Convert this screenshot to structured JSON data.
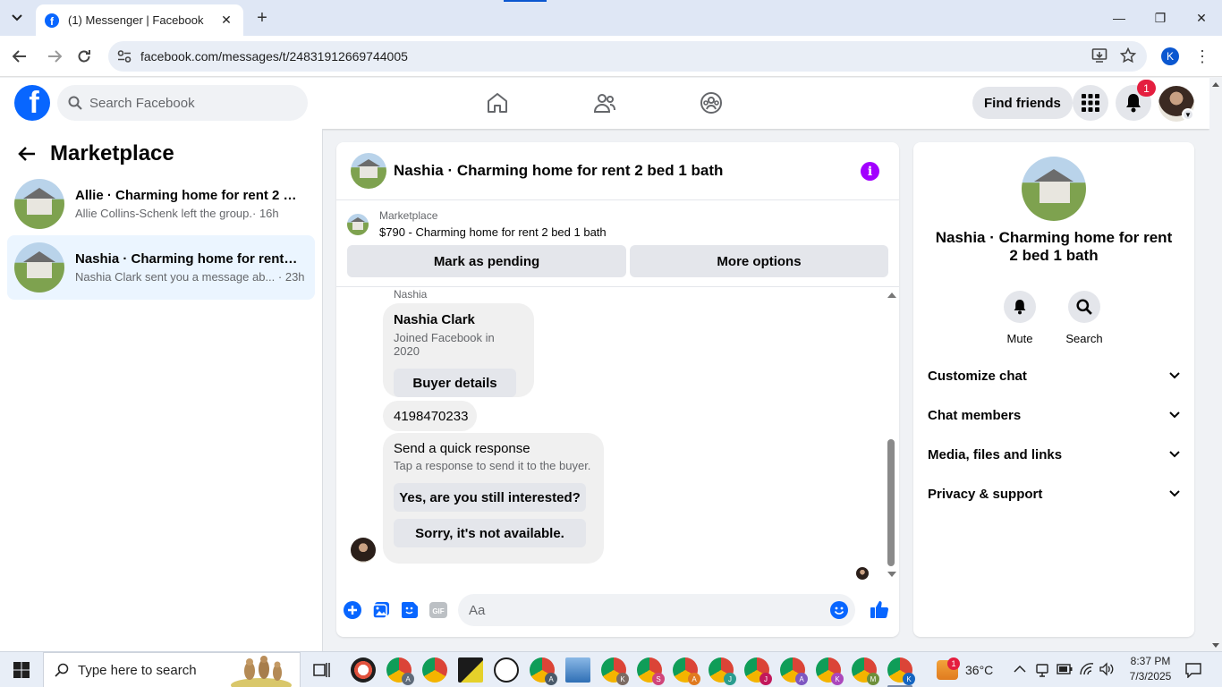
{
  "browser": {
    "tab_title": "(1) Messenger | Facebook",
    "url": "facebook.com/messages/t/24831912669744005",
    "profile_initial": "K"
  },
  "header": {
    "search_placeholder": "Search Facebook",
    "find_friends": "Find friends",
    "notification_count": "1"
  },
  "left_panel": {
    "title": "Marketplace",
    "conversations": [
      {
        "name": "Allie · Charming home for rent 2 b...",
        "preview": "Allie Collins-Schenk left the group.",
        "time": "· 16h"
      },
      {
        "name": "Nashia · Charming home for rent 2...",
        "preview": "Nashia Clark sent you a message ab...",
        "time": "· 23h"
      }
    ]
  },
  "chat": {
    "title": "Nashia · Charming home for rent 2 bed 1 bath",
    "listing_category": "Marketplace",
    "listing_name": "$790 - Charming home for rent 2 bed 1 bath",
    "mark_pending": "Mark as pending",
    "more_options": "More options",
    "sender_label": "Nashia",
    "profile_card": {
      "name": "Nashia Clark",
      "joined": "Joined Facebook in 2020",
      "button": "Buyer details"
    },
    "phone_message": "4198470233",
    "quick_response": {
      "title": "Send a quick response",
      "subtitle": "Tap a response to send it to the buyer.",
      "option1": "Yes, are you still interested?",
      "option2": "Sorry, it's not available."
    },
    "input_placeholder": "Aa"
  },
  "info_panel": {
    "title": "Nashia · Charming home for rent 2 bed 1 bath",
    "mute": "Mute",
    "search": "Search",
    "sections": [
      "Customize chat",
      "Chat members",
      "Media, files and links",
      "Privacy & support"
    ]
  },
  "taskbar": {
    "search_placeholder": "Type here to search",
    "weather_badge": "1",
    "temperature": "36°C",
    "time": "8:37 PM",
    "date": "7/3/2025",
    "app_badges": [
      "A",
      "A",
      "K",
      "S",
      "A",
      "J",
      "J",
      "A",
      "K",
      "M",
      "K"
    ]
  },
  "colors": {
    "facebook_blue": "#0866ff",
    "messenger_purple": "#a200ff",
    "notification_red": "#e41e3f",
    "active_conversation": "#ebf5ff"
  }
}
